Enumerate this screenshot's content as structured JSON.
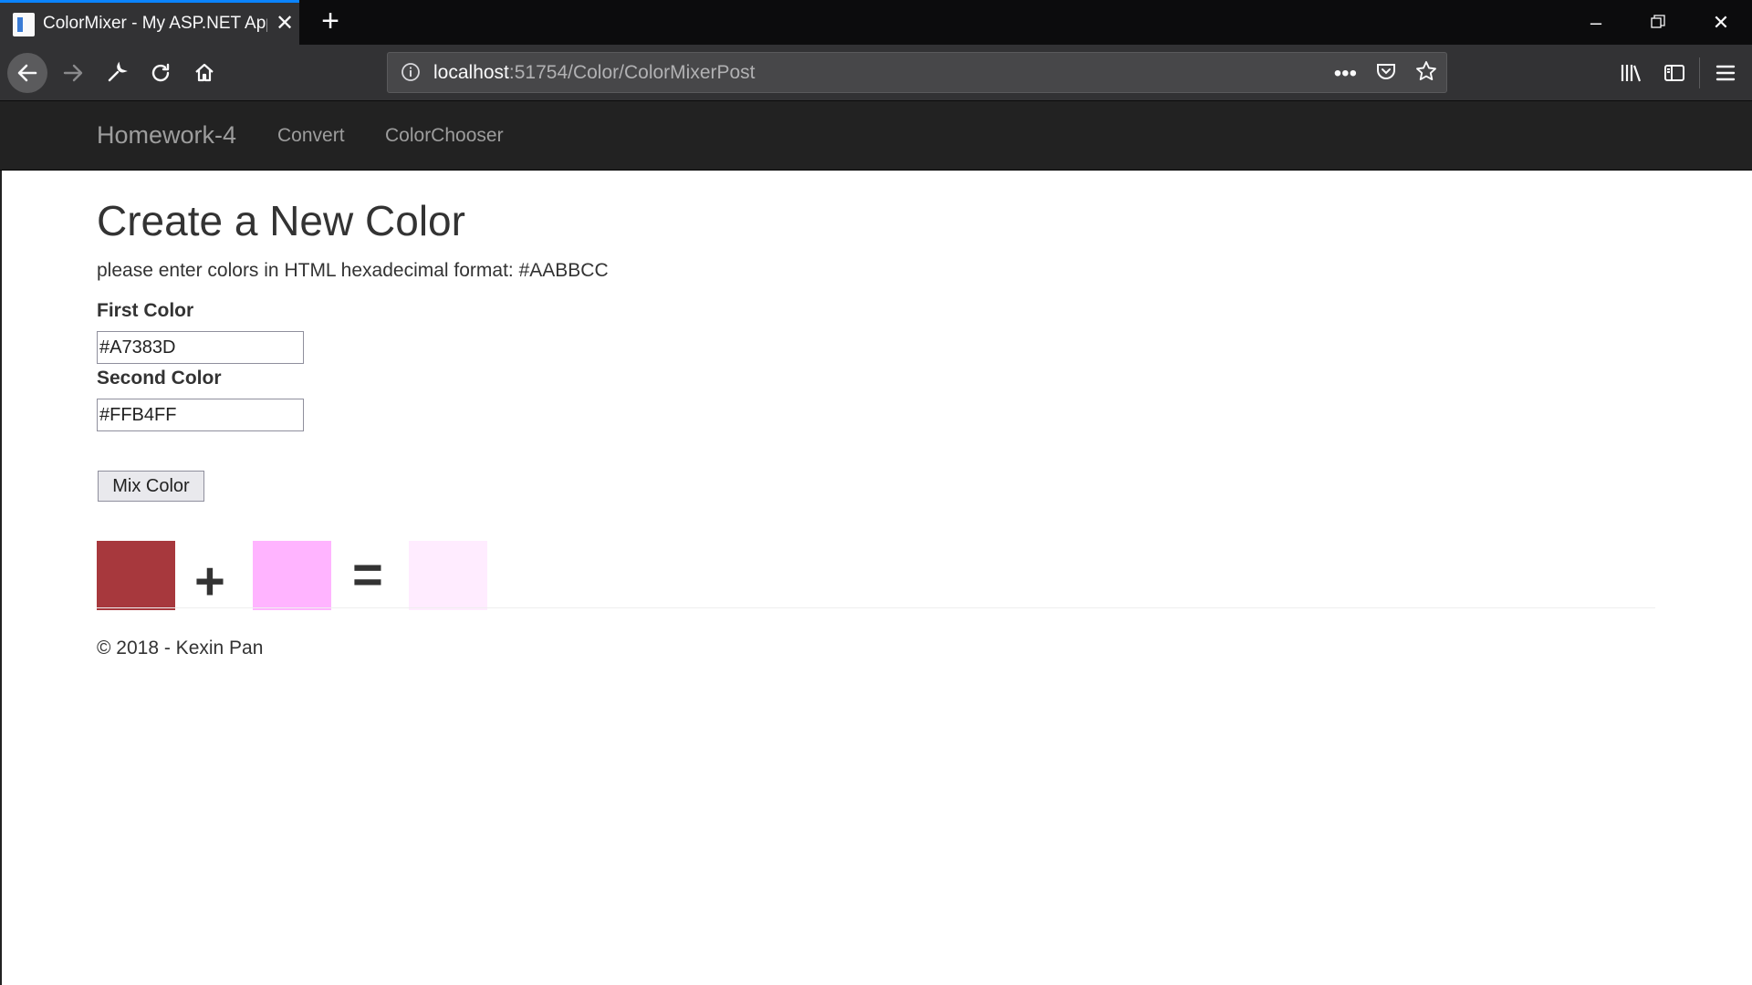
{
  "browser": {
    "tab_title": "ColorMixer - My ASP.NET Application",
    "url_host": "localhost",
    "url_rest": ":51754/Color/ColorMixerPost",
    "accent_color": "#0a84ff"
  },
  "site": {
    "brand": "Homework-4",
    "nav_links": [
      "Convert",
      "ColorChooser"
    ]
  },
  "page": {
    "title": "Create a New Color",
    "instructions": "please enter colors in HTML hexadecimal format: #AABBCC",
    "first_color_label": "First Color",
    "first_color_value": "#A7383D",
    "second_color_label": "Second Color",
    "second_color_value": "#FFB4FF",
    "mix_button": "Mix Color",
    "plus": "+",
    "equals": "=",
    "swatches": {
      "first": "#A7383D",
      "second": "#FFB4FF",
      "result": "#FFECFF"
    }
  },
  "footer": {
    "copyright": "© 2018 - Kexin Pan"
  }
}
